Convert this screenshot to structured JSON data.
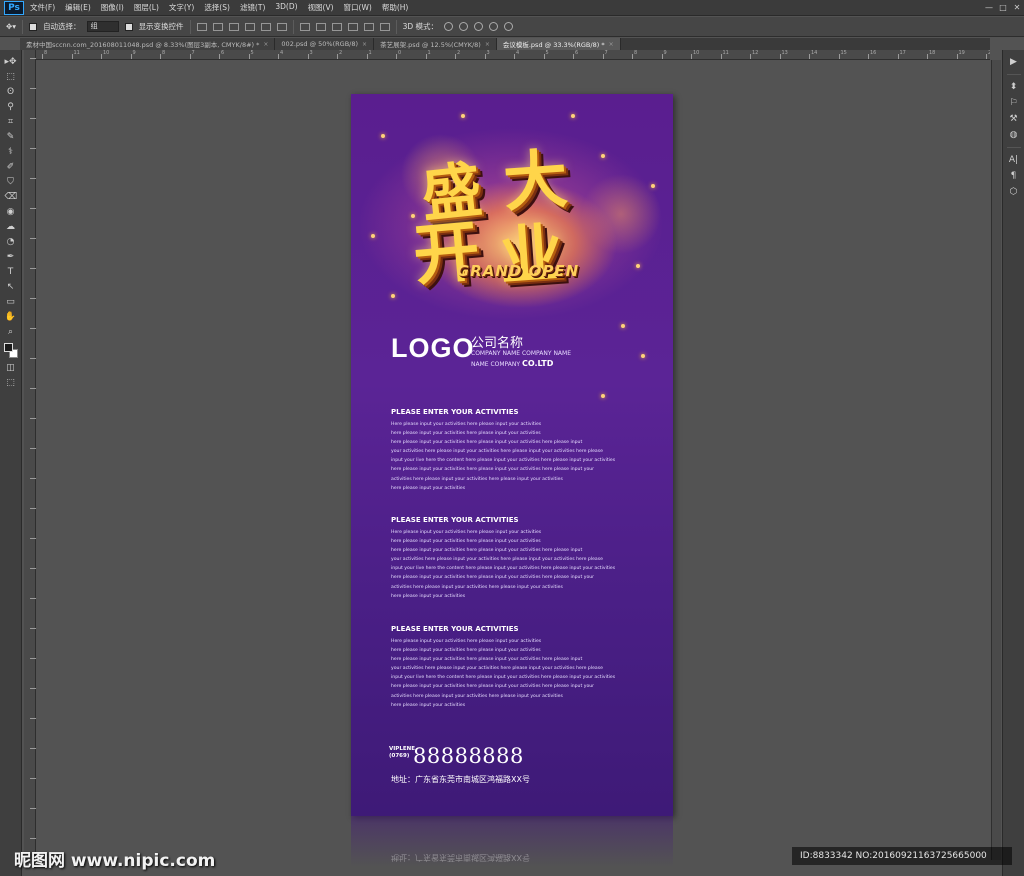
{
  "app": {
    "logo": "Ps",
    "menu": [
      "文件(F)",
      "编辑(E)",
      "图像(I)",
      "图层(L)",
      "文字(Y)",
      "选择(S)",
      "滤镜(T)",
      "3D(D)",
      "视图(V)",
      "窗口(W)",
      "帮助(H)"
    ],
    "window_buttons": [
      "—",
      "□",
      "✕"
    ]
  },
  "options": {
    "auto_select_label": "自动选择：",
    "auto_select_value": "组",
    "show_transform_label": "显示变换控件",
    "mode_3d_label": "3D 模式："
  },
  "tabs": [
    {
      "label": "素材中国sccnn.com_20160801104​8.psd @ 8.33%(图层3副本, CMYK/8#) *",
      "active": false
    },
    {
      "label": "002.psd @ 50%(RGB/8)",
      "active": false
    },
    {
      "label": "茶艺展架.psd @ 12.5%(CMYK/8)",
      "active": false
    },
    {
      "label": "会议模板.psd @ 33.3%(RGB/8) *",
      "active": true
    }
  ],
  "ruler_numbers": [
    "8",
    "11",
    "10",
    "9",
    "8",
    "7",
    "6",
    "5",
    "4",
    "3",
    "2",
    "1",
    "0",
    "1",
    "2",
    "3",
    "4",
    "5",
    "6",
    "7",
    "8",
    "9",
    "10",
    "11",
    "12",
    "13",
    "14",
    "15",
    "16",
    "17",
    "18",
    "19",
    "20"
  ],
  "tools": [
    "▸✥",
    "⬚",
    "ʘ",
    "⚲",
    "⌗",
    "✎",
    "⚕",
    "✐",
    "⛉",
    "⌫",
    "◉",
    "☁",
    "◔",
    "✒",
    "T",
    "↖",
    "▭",
    "✋",
    "⌕"
  ],
  "right_icons": [
    "▶",
    "⬍",
    "⚐",
    "⚒",
    "◍",
    "A|",
    "¶",
    "⬡"
  ],
  "poster": {
    "headline_chars": [
      "盛",
      "大",
      "开",
      "业"
    ],
    "grand_open": "GRAND OPEN",
    "logo": "LOGO",
    "company_name": "公司名称",
    "company_en_1": "COMPANY NAME COMPANY NAME",
    "company_en_2": "NAME COMPANY",
    "company_en_3": "CO.LTD",
    "activities": [
      {
        "title": "PLEASE ENTER YOUR ACTIVITIES",
        "lines": [
          "Here please input your activities here please input your activities",
          "here please input your activities here please input your activities",
          "here please input your activities here please input your activities here please input",
          "your activities here please input your activities here please input your activities here please",
          "input your live here the content here please input your activities here please input your activities",
          "here please input your activities here please input your activities here please input your",
          "  activities here please input your activities here please input your activities",
          "here please input your activities"
        ]
      },
      {
        "title": "PLEASE ENTER YOUR ACTIVITIES",
        "lines": [
          "Here please input your activities here please input your activities",
          "here please input your activities here please input your activities",
          "here please input your activities here please input your activities here please input",
          "your activities here please input your activities here please input your activities here please",
          "input your live here the content here please input your activities here please input your activities",
          "here please input your activities here please input your activities here please input your",
          "  activities here please input your activities here please input your activities",
          "here please input your activities"
        ]
      },
      {
        "title": "PLEASE ENTER YOUR ACTIVITIES",
        "lines": [
          "Here please input your activities here please input your activities",
          "here please input your activities here please input your activities",
          "here please input your activities here please input your activities here please input",
          "your activities here please input your activities here please input your activities here please",
          "input your live here the content here please input your activities here please input your activities",
          "here please input your activities here please input your activities here please input your",
          "  activities here please input your activities here please input your activities",
          "here please input your activities"
        ]
      }
    ],
    "vip_label": "VIPLENE",
    "area_code": "(0769)",
    "phone": "88888888",
    "address": "地址：广东省东莞市南城区鸿福路XX号"
  },
  "reflection_address": "地址：广东省东莞市南城区鸿福路XX号",
  "watermark": {
    "left": "昵图网 www.nipic.com",
    "right": "ID:8833342 NO:20160921163725665000"
  },
  "colors": {
    "poster_purple": "#5a1e8f",
    "headline_gold": "#ffd54a",
    "ps_blue": "#31a8ff"
  }
}
